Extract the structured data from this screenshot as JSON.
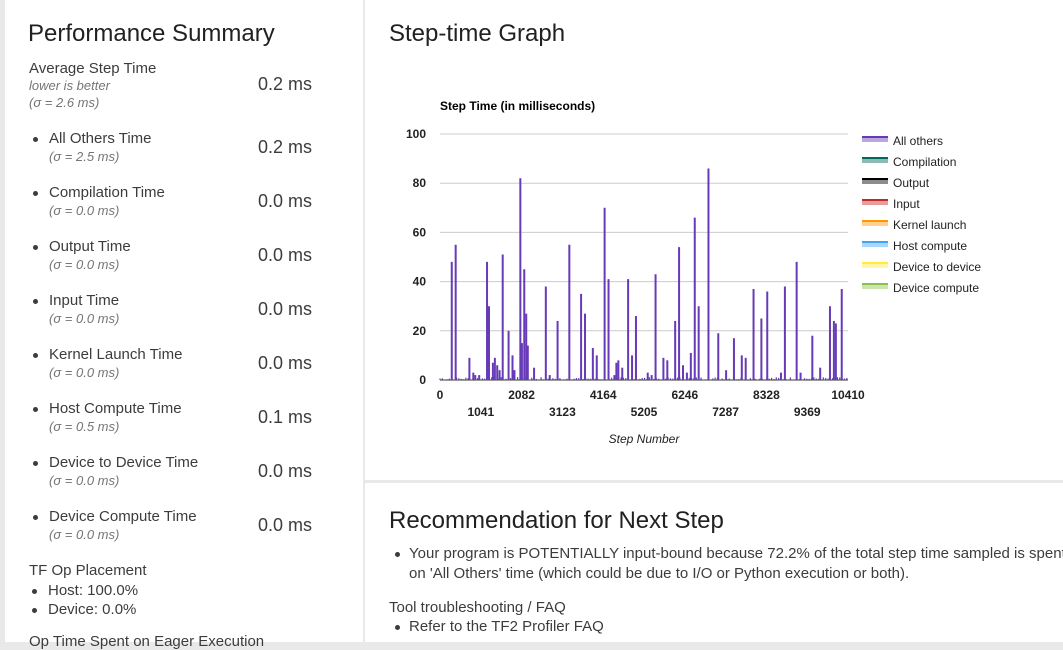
{
  "summary": {
    "title": "Performance Summary",
    "average": {
      "label": "Average Step Time",
      "note": "lower is better",
      "sigma": "(σ = 2.6 ms)",
      "value": "0.2 ms"
    },
    "breakdown": [
      {
        "label": "All Others Time",
        "sigma": "(σ = 2.5 ms)",
        "value": "0.2 ms"
      },
      {
        "label": "Compilation Time",
        "sigma": "(σ = 0.0 ms)",
        "value": "0.0 ms"
      },
      {
        "label": "Output Time",
        "sigma": "(σ = 0.0 ms)",
        "value": "0.0 ms"
      },
      {
        "label": "Input Time",
        "sigma": "(σ = 0.0 ms)",
        "value": "0.0 ms"
      },
      {
        "label": "Kernel Launch Time",
        "sigma": "(σ = 0.0 ms)",
        "value": "0.0 ms"
      },
      {
        "label": "Host Compute Time",
        "sigma": "(σ = 0.5 ms)",
        "value": "0.1 ms"
      },
      {
        "label": "Device to Device Time",
        "sigma": "(σ = 0.0 ms)",
        "value": "0.0 ms"
      },
      {
        "label": "Device Compute Time",
        "sigma": "(σ = 0.0 ms)",
        "value": "0.0 ms"
      }
    ],
    "placement": {
      "title": "TF Op Placement",
      "items": [
        "Host: 100.0%",
        "Device: 0.0%"
      ]
    },
    "cutoff_text": "Op Time Spent on Eager Execution"
  },
  "graph": {
    "title": "Step-time Graph"
  },
  "chart_data": {
    "type": "bar",
    "title": "Step Time (in milliseconds)",
    "xlabel": "Step Number",
    "ylabel": "",
    "xlim": [
      0,
      10410
    ],
    "ylim": [
      0,
      100
    ],
    "yticks": [
      0,
      20,
      40,
      60,
      80,
      100
    ],
    "xticks_row1": [
      0,
      2082,
      4164,
      6246,
      8328,
      10410
    ],
    "xticks_row2": [
      1041,
      3123,
      5205,
      7287,
      9369
    ],
    "grid": true,
    "legend_position": "right",
    "legend": [
      {
        "name": "All others",
        "color": "#673ab7"
      },
      {
        "name": "Compilation",
        "color": "#00695c"
      },
      {
        "name": "Output",
        "color": "#000000"
      },
      {
        "name": "Input",
        "color": "#c62828"
      },
      {
        "name": "Kernel launch",
        "color": "#ff9800"
      },
      {
        "name": "Host compute",
        "color": "#42a5f5"
      },
      {
        "name": "Device to device",
        "color": "#ffeb3b"
      },
      {
        "name": "Device compute",
        "color": "#8bc34a"
      }
    ],
    "series": [
      {
        "name": "All others",
        "x": [
          300,
          400,
          750,
          850,
          900,
          1000,
          1200,
          1250,
          1350,
          1400,
          1460,
          1520,
          1600,
          1750,
          1850,
          1900,
          2050,
          2090,
          2150,
          2200,
          2240,
          2400,
          2700,
          2800,
          3000,
          3300,
          3600,
          3700,
          3900,
          4000,
          4200,
          4300,
          4450,
          4500,
          4550,
          4650,
          4800,
          4900,
          5000,
          5300,
          5400,
          5500,
          5700,
          5800,
          6000,
          6100,
          6200,
          6300,
          6400,
          6500,
          6600,
          6850,
          7100,
          7300,
          7500,
          7700,
          7800,
          8000,
          8200,
          8350,
          8700,
          8800,
          9100,
          9200,
          9500,
          9700,
          9950,
          10050,
          10100,
          10250
        ],
        "values": [
          48,
          55,
          9,
          3,
          2,
          2,
          48,
          30,
          7,
          9,
          6,
          4,
          51,
          20,
          10,
          4,
          82,
          15,
          45,
          27,
          14,
          5,
          38,
          2,
          24,
          55,
          35,
          27,
          13,
          10,
          70,
          41,
          2,
          7,
          8,
          5,
          41,
          10,
          26,
          3,
          2,
          43,
          9,
          8,
          24,
          54,
          6,
          3,
          11,
          66,
          30,
          86,
          19,
          4,
          17,
          10,
          9,
          37,
          25,
          36,
          3,
          38,
          48,
          3,
          18,
          5,
          30,
          24,
          23,
          37
        ]
      }
    ],
    "peak_count_note": ""
  },
  "recommendation": {
    "title": "Recommendation for Next Step",
    "bullets": [
      "Your program is POTENTIALLY input-bound because 72.2% of the total step time sampled is spent on 'All Others' time (which could be due to I/O or Python execution or both)."
    ],
    "faq_title": "Tool troubleshooting / FAQ",
    "faq_items": [
      "Refer to the TF2 Profiler FAQ"
    ]
  }
}
